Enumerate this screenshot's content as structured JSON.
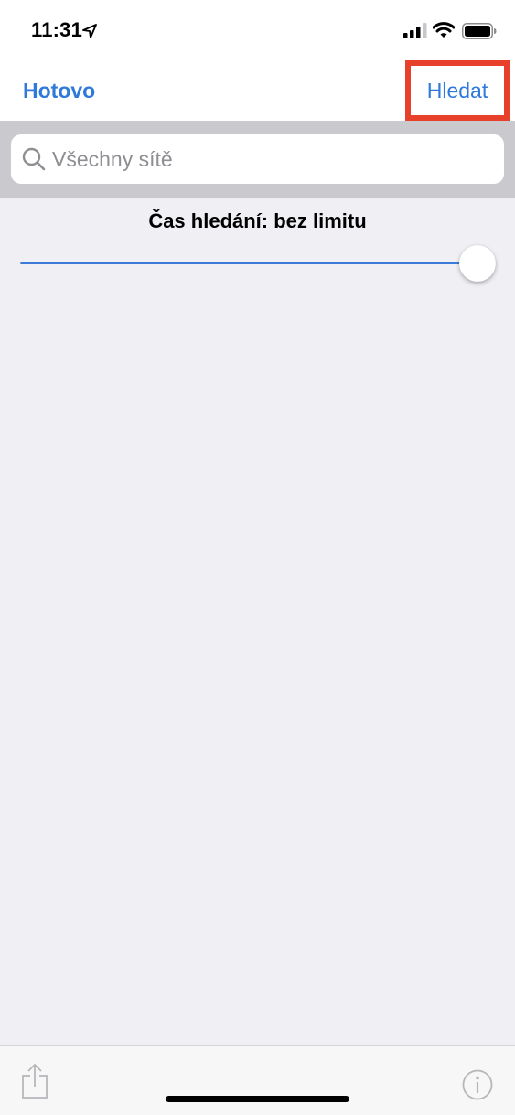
{
  "status_bar": {
    "time": "11:31",
    "icons": [
      "location-arrow-icon",
      "cellular-signal-icon",
      "wifi-icon",
      "battery-icon"
    ]
  },
  "nav": {
    "done_label": "Hotovo",
    "search_label": "Hledat"
  },
  "search": {
    "placeholder": "Všechny sítě",
    "value": ""
  },
  "search_time": {
    "label": "Čas hledání: bez limitu",
    "slider_value": 1.0
  },
  "toolbar": {
    "icons": [
      "share-icon",
      "info-icon"
    ]
  },
  "colors": {
    "accent": "#2f7ad9",
    "highlight": "#e8412b",
    "background": "#efeff4",
    "slider_fill": "#3d7bd9"
  }
}
